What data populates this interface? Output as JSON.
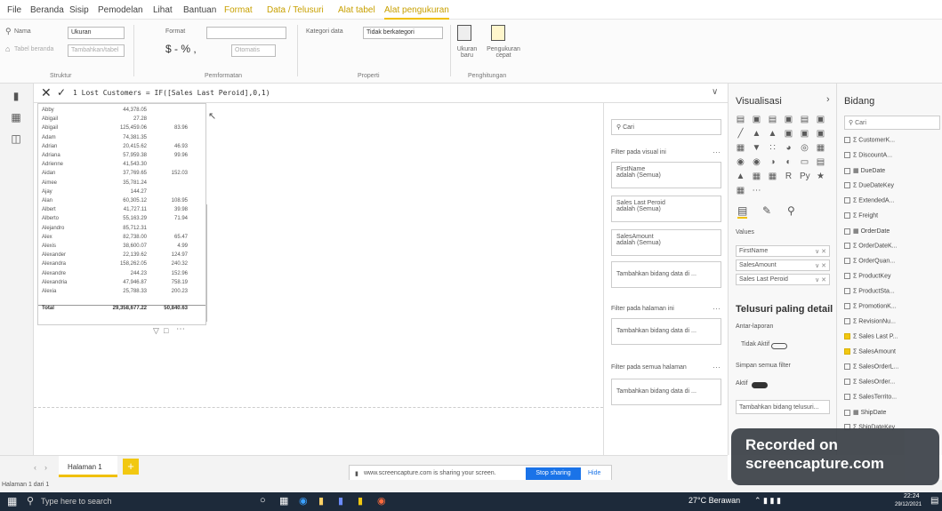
{
  "menu": {
    "items": [
      "File",
      "Beranda",
      "Sisip",
      "Pemodelan",
      "Lihat",
      "Bantuan"
    ],
    "context_items": [
      "Format",
      "Data / Telusuri",
      "Alat tabel"
    ],
    "active_item": "Alat pengukuran"
  },
  "ribbon": {
    "name_label": "Nama",
    "name_value": "Ukuran",
    "home_table_label": "Tabel beranda",
    "home_table_value": "Tambahkan/tabel",
    "format_label": "Format",
    "format_value": "",
    "format_symbols": "$ - % ,",
    "format_decimals": "Otomatis",
    "category_label": "Kategori data",
    "category_value": "Tidak berkategori",
    "new_measure": "Ukuran baru",
    "quick_measure": "Pengukuran cepat",
    "groups": [
      "Struktur",
      "Pemformatan",
      "Properti",
      "Penghitungan"
    ]
  },
  "formula": {
    "line": "1  Lost Customers = IF([Sales Last Peroid],0,1)"
  },
  "table": {
    "rows": [
      [
        "Abby",
        "44,378.05",
        ""
      ],
      [
        "Abigail",
        "27.28",
        ""
      ],
      [
        "Abigail",
        "125,459.06",
        "83.96"
      ],
      [
        "Adam",
        "74,381.35",
        ""
      ],
      [
        "Adrian",
        "20,415.62",
        "46.93"
      ],
      [
        "Adriana",
        "57,959.38",
        "99.96"
      ],
      [
        "Adrienne",
        "41,543.30",
        ""
      ],
      [
        "Aidan",
        "37,769.65",
        "152.03"
      ],
      [
        "Aimee",
        "35,781.24",
        ""
      ],
      [
        "Ajay",
        "144.27",
        ""
      ],
      [
        "Alan",
        "60,305.12",
        "108.95"
      ],
      [
        "Albert",
        "41,727.11",
        "39.98"
      ],
      [
        "Alberto",
        "55,163.29",
        "71.94"
      ],
      [
        "Alejandro",
        "85,712.31",
        ""
      ],
      [
        "Alex",
        "82,738.00",
        "65.47"
      ],
      [
        "Alexis",
        "38,600.07",
        "4.99"
      ],
      [
        "Alexander",
        "22,139.62",
        "124.97"
      ],
      [
        "Alexandra",
        "158,262.05",
        "240.32"
      ],
      [
        "Alexandre",
        "244.23",
        "152.96"
      ],
      [
        "Alexandria",
        "47,946.87",
        "758.19"
      ],
      [
        "Alexia",
        "25,788.33",
        "200.23"
      ]
    ],
    "total_label": "Total",
    "total_sales": "29,358,677.22",
    "total_last": "50,840.63"
  },
  "filters": {
    "search_placeholder": "Cari",
    "on_visual_title": "Filter pada visual ini",
    "cards": [
      {
        "field": "FirstName",
        "state": "adalah (Semua)"
      },
      {
        "field": "Sales Last Peroid",
        "state": "adalah (Semua)"
      },
      {
        "field": "SalesAmount",
        "state": "adalah (Semua)"
      }
    ],
    "add_field": "Tambahkan bidang data di ...",
    "on_page_title": "Filter pada halaman ini",
    "on_all_title": "Filter pada semua halaman"
  },
  "visualizations": {
    "title": "Visualisasi",
    "values_label": "Values",
    "values": [
      "FirstName",
      "SalesAmount",
      "Sales Last Peroid"
    ],
    "drill_title": "Telusuri paling detail",
    "cross_report": "Antar-laporan",
    "cross_state": "Tidak Aktif",
    "keep_filters": "Simpan semua filter",
    "keep_state": "Aktif",
    "add_drill": "Tambahkan bidang telusuri..."
  },
  "fields": {
    "title": "Bidang",
    "search_placeholder": "Cari",
    "items": [
      {
        "label": "CustomerK...",
        "checked": false,
        "table": false
      },
      {
        "label": "DiscountA...",
        "checked": false,
        "table": false
      },
      {
        "label": "DueDate",
        "checked": false,
        "table": true
      },
      {
        "label": "DueDateKey",
        "checked": false,
        "table": false
      },
      {
        "label": "ExtendedA...",
        "checked": false,
        "table": false
      },
      {
        "label": "Freight",
        "checked": false,
        "table": false
      },
      {
        "label": "OrderDate",
        "checked": false,
        "table": true
      },
      {
        "label": "OrderDateK...",
        "checked": false,
        "table": false
      },
      {
        "label": "OrderQuan...",
        "checked": false,
        "table": false
      },
      {
        "label": "ProductKey",
        "checked": false,
        "table": false
      },
      {
        "label": "ProductSta...",
        "checked": false,
        "table": false
      },
      {
        "label": "PromotionK...",
        "checked": false,
        "table": false
      },
      {
        "label": "RevisionNu...",
        "checked": false,
        "table": false
      },
      {
        "label": "Sales Last P...",
        "checked": true,
        "table": false
      },
      {
        "label": "SalesAmount",
        "checked": true,
        "table": false
      },
      {
        "label": "SalesOrderL...",
        "checked": false,
        "table": false
      },
      {
        "label": "SalesOrder...",
        "checked": false,
        "table": false
      },
      {
        "label": "SalesTerrito...",
        "checked": false,
        "table": false
      },
      {
        "label": "ShipDate",
        "checked": false,
        "table": true
      },
      {
        "label": "ShipDateKey",
        "checked": false,
        "table": false
      }
    ]
  },
  "pages": {
    "tab_label": "Halaman 1",
    "add_label": "+",
    "status": "Halaman 1 dari 1"
  },
  "share": {
    "message": "www.screencapture.com is sharing your screen.",
    "stop": "Stop sharing",
    "hide": "Hide"
  },
  "watermark": {
    "line1": "Recorded on",
    "line2": "screencapture.com"
  },
  "taskbar": {
    "search": "Type here to search",
    "weather": "27°C  Berawan",
    "time": "22:24",
    "date": "29/12/2021"
  }
}
